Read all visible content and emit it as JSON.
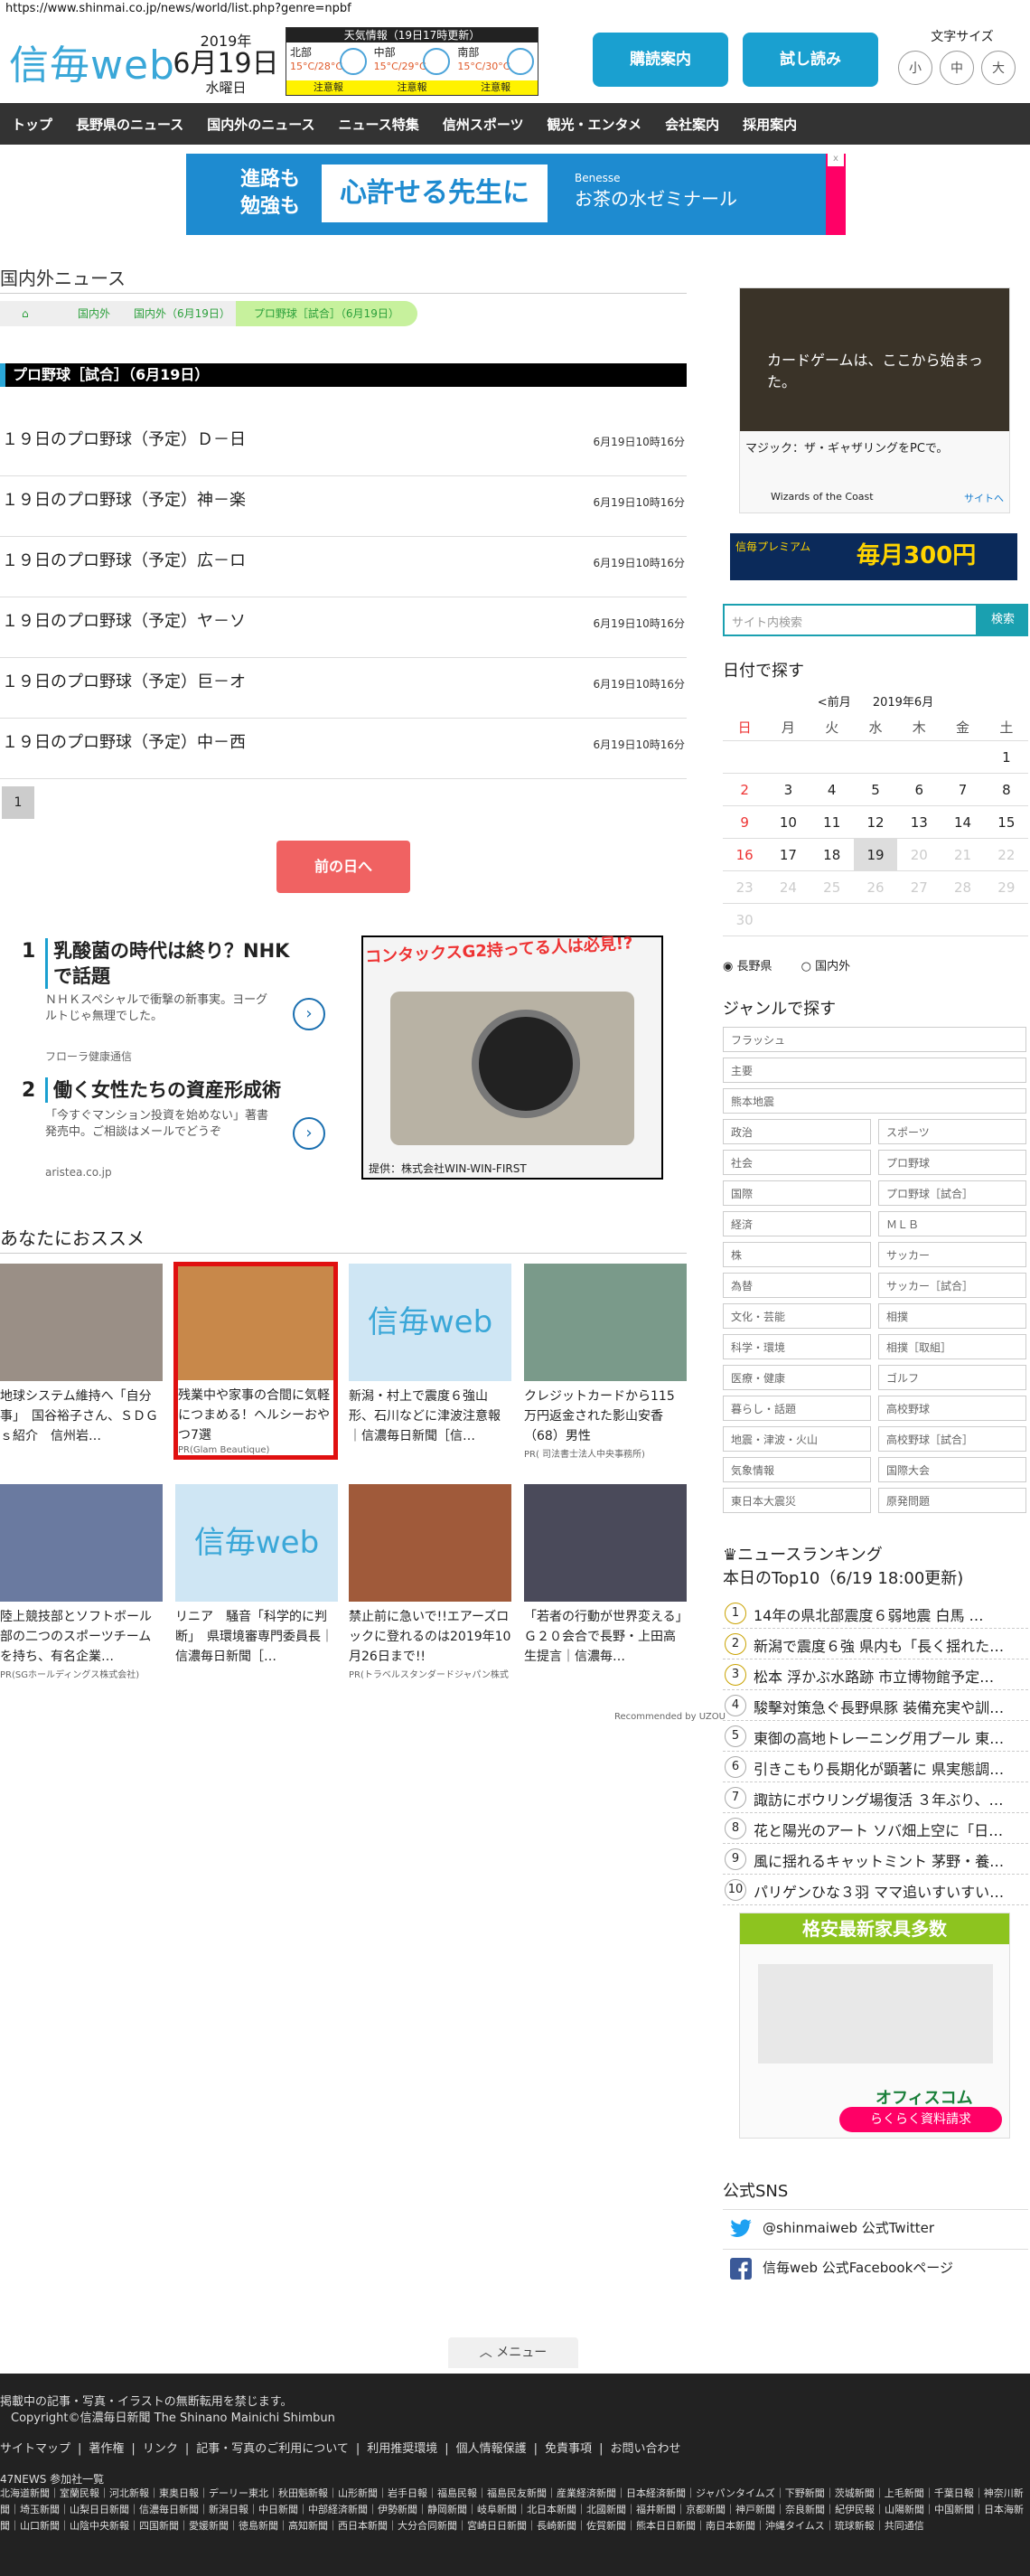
{
  "browser": {
    "url": "https://www.shinmai.co.jp/news/world/list.php?genre=npbf"
  },
  "header": {
    "logo": "信毎web",
    "year": "2019年",
    "date": "6月19日",
    "dow": "水曜日",
    "weather_title": "天気情報（19日17時更新）",
    "weather": [
      {
        "region": "北部",
        "temp": "15°C/28°C",
        "warn": "注意報"
      },
      {
        "region": "中部",
        "temp": "15°C/29°C",
        "warn": "注意報"
      },
      {
        "region": "南部",
        "temp": "15°C/30°C",
        "warn": "注意報"
      }
    ],
    "buttons": [
      "購読案内",
      "試し読み"
    ],
    "font_size_label": "文字サイズ",
    "font_sizes": [
      "小",
      "中",
      "大"
    ]
  },
  "nav": [
    "トップ",
    "長野県のニュース",
    "国内外のニュース",
    "ニュース特集",
    "信州スポーツ",
    "観光・エンタメ",
    "会社案内",
    "採用案内"
  ],
  "banner_ad": {
    "left": "進路も\n勉強も",
    "mid": "心許せる先生に",
    "right_brand": "Benesse",
    "right": "お茶の水ゼミナール"
  },
  "section_title": "国内外ニュース",
  "breadcrumb": [
    "国内外",
    "国内外（6月19日）",
    "プロ野球［試合］（6月19日）"
  ],
  "genre_header": "プロ野球［試合］（6月19日）",
  "articles": [
    {
      "title": "１９日のプロ野球（予定）Ｄ－日",
      "time": "6月19日10時16分"
    },
    {
      "title": "１９日のプロ野球（予定）神－楽",
      "time": "6月19日10時16分"
    },
    {
      "title": "１９日のプロ野球（予定）広－ロ",
      "time": "6月19日10時16分"
    },
    {
      "title": "１９日のプロ野球（予定）ヤ－ソ",
      "time": "6月19日10時16分"
    },
    {
      "title": "１９日のプロ野球（予定）巨－オ",
      "time": "6月19日10時16分"
    },
    {
      "title": "１９日のプロ野球（予定）中－西",
      "time": "6月19日10時16分"
    }
  ],
  "pager": "1",
  "prev_button": "前の日へ",
  "pr_ads": [
    {
      "num": "1",
      "title": "乳酸菌の時代は終り？NHKで話題",
      "body": "ＮＨＫスペシャルで衝撃の新事実。ヨーグルトじゃ無理でした。",
      "sponsor": "フローラ健康通信"
    },
    {
      "num": "2",
      "title": "働く女性たちの資産形成術",
      "body": "「今すぐマンション投資を始めない」著書発売中。ご相談はメールでどうぞ",
      "sponsor": "aristea.co.jp"
    }
  ],
  "camera_ad": {
    "caption": "コンタックスG2持ってる人は必見!?",
    "credit": "提供：株式会社WIN-WIN-FIRST"
  },
  "recommend_title": "あなたにおススメ",
  "recommend": [
    {
      "title": "地球システム維持へ「自分事」　国谷裕子さん、ＳＤＧｓ紹介　信州岩…",
      "pr": ""
    },
    {
      "title": "残業中や家事の合間に気軽につまめる！ヘルシーおやつ7選",
      "pr": "PR(Glam Beautique)"
    },
    {
      "title": "新潟・村上で震度６強山形、石川などに津波注意報｜信濃毎日新聞［信…",
      "pr": ""
    },
    {
      "title": "クレジットカードから115万円返金された影山安香（68）男性",
      "pr": "PR( 司法書士法人中央事務所)"
    },
    {
      "title": "陸上競技部とソフトボール部の二つのスポーツチームを持ち、有名企業…",
      "pr": "PR(SGホールディングス株式会社)"
    },
    {
      "title": "リニア　騒音「科学的に判断」　県環境審専門委員長｜信濃毎日新聞［…",
      "pr": ""
    },
    {
      "title": "禁止前に急いで!!エアーズロックに登れるのは2019年10月26日まで!!",
      "pr": "PR(トラベルスタンダードジャパン株式"
    },
    {
      "title": "「若者の行動が世界変える」Ｇ２０会合で長野・上田高生提言｜信濃毎…",
      "pr": ""
    }
  ],
  "recommend_logo": "信毎web",
  "recommended_by": "Recommended by UZOU",
  "sidebar_ad": {
    "headline": "カードゲームは、ここから始まった。",
    "line1": "マジック：ザ・ギャザリングをPCで。",
    "brand": "Wizards of the Coast",
    "site": "サイトへ"
  },
  "premium_ad": {
    "t1": "信毎プレミアム",
    "t2": "毎月300円"
  },
  "search": {
    "placeholder": "サイト内検索",
    "button": "検索"
  },
  "calendar": {
    "title": "日付で探す",
    "prev": "<前月",
    "month": "2019年6月",
    "weekdays": [
      "日",
      "月",
      "火",
      "水",
      "木",
      "金",
      "土"
    ],
    "days": [
      "",
      "",
      "",
      "",
      "",
      "",
      "1",
      "2",
      "3",
      "4",
      "5",
      "6",
      "7",
      "8",
      "9",
      "10",
      "11",
      "12",
      "13",
      "14",
      "15",
      "16",
      "17",
      "18",
      "19",
      "20",
      "21",
      "22",
      "23",
      "24",
      "25",
      "26",
      "27",
      "28",
      "29",
      "30",
      "",
      "",
      "",
      "",
      "",
      ""
    ],
    "today": "19",
    "radios": [
      "長野県",
      "国内外"
    ]
  },
  "genre_title": "ジャンルで探す",
  "genres_full": [
    "フラッシュ",
    "主要",
    "熊本地震"
  ],
  "genres": [
    "政治",
    "スポーツ",
    "社会",
    "プロ野球",
    "国際",
    "プロ野球［試合］",
    "経済",
    "ＭＬＢ",
    "株",
    "サッカー",
    "為替",
    "サッカー［試合］",
    "文化・芸能",
    "相撲",
    "科学・環境",
    "相撲［取組］",
    "医療・健康",
    "ゴルフ",
    "暮らし・話題",
    "高校野球",
    "地震・津波・火山",
    "高校野球［試合］",
    "気象情報",
    "国際大会",
    "東日本大震災",
    "原発問題"
  ],
  "ranking": {
    "title": "ニュースランキング",
    "subtitle": "本日のTop10（6/19 18:00更新)",
    "items": [
      "14年の県北部震度６弱地震 白馬 …",
      "新潟で震度６強 県内も「長く揺れた…",
      "松本 浮かぶ水路跡 市立博物館予定…",
      "駿擊対策急ぐ長野県豚 装備充実や訓…",
      "東御の高地トレーニング用プール 東…",
      "引きこもり長期化が顕著に 県実態調…",
      "諏訪にボウリング場復活 ３年ぶり、…",
      "花と陽光のアート ソバ畑上空に「日…",
      "風に揺れるキャットミント 茅野・養…",
      "パリゲンひな３羽 ママ追いすいすい…"
    ]
  },
  "furniture_ad": {
    "top": "格安最新家具多数",
    "brand": "オフィスコム",
    "btn": "らくらく資料請求"
  },
  "sns": {
    "title": "公式SNS",
    "twitter": "@shinmaiweb 公式Twitter",
    "facebook": "信毎web 公式Facebookページ"
  },
  "menu_button": "メニュー",
  "footer": {
    "notice": "掲載中の記事・写真・イラストの無断転用を禁じます。",
    "copyright": "Copyright©信濃毎日新聞 The Shinano Mainichi Shimbun",
    "links": [
      "サイトマップ",
      "著作権",
      "リンク",
      "記事・写真のご利用について",
      "利用推奨環境",
      "個人情報保護",
      "免責事項",
      "お問い合わせ"
    ],
    "news47": "47NEWS 参加社一覧",
    "papers": "北海道新聞｜室蘭民報｜河北新報｜東奥日報｜デーリー東北｜秋田魁新報｜山形新聞｜岩手日報｜福島民報｜福島民友新聞｜産業経済新聞｜日本経済新聞｜ジャパンタイムズ｜下野新聞｜茨城新聞｜上毛新聞｜千葉日報｜神奈川新聞｜埼玉新聞｜山梨日日新聞｜信濃毎日新聞｜新潟日報｜中日新聞｜中部経済新聞｜伊勢新聞｜静岡新聞｜岐阜新聞｜北日本新聞｜北國新聞｜福井新聞｜京都新聞｜神戸新聞｜奈良新聞｜紀伊民報｜山陽新聞｜中国新聞｜日本海新聞｜山口新聞｜山陰中央新報｜四国新聞｜愛媛新聞｜徳島新聞｜高知新聞｜西日本新聞｜大分合同新聞｜宮崎日日新聞｜長崎新聞｜佐賀新聞｜熊本日日新聞｜南日本新聞｜沖縄タイムス｜琉球新報｜共同通信"
  },
  "colors": {
    "accent": "#1aa0d0",
    "nav": "#333333",
    "prev": "#f06262",
    "warn": "#fff200"
  }
}
